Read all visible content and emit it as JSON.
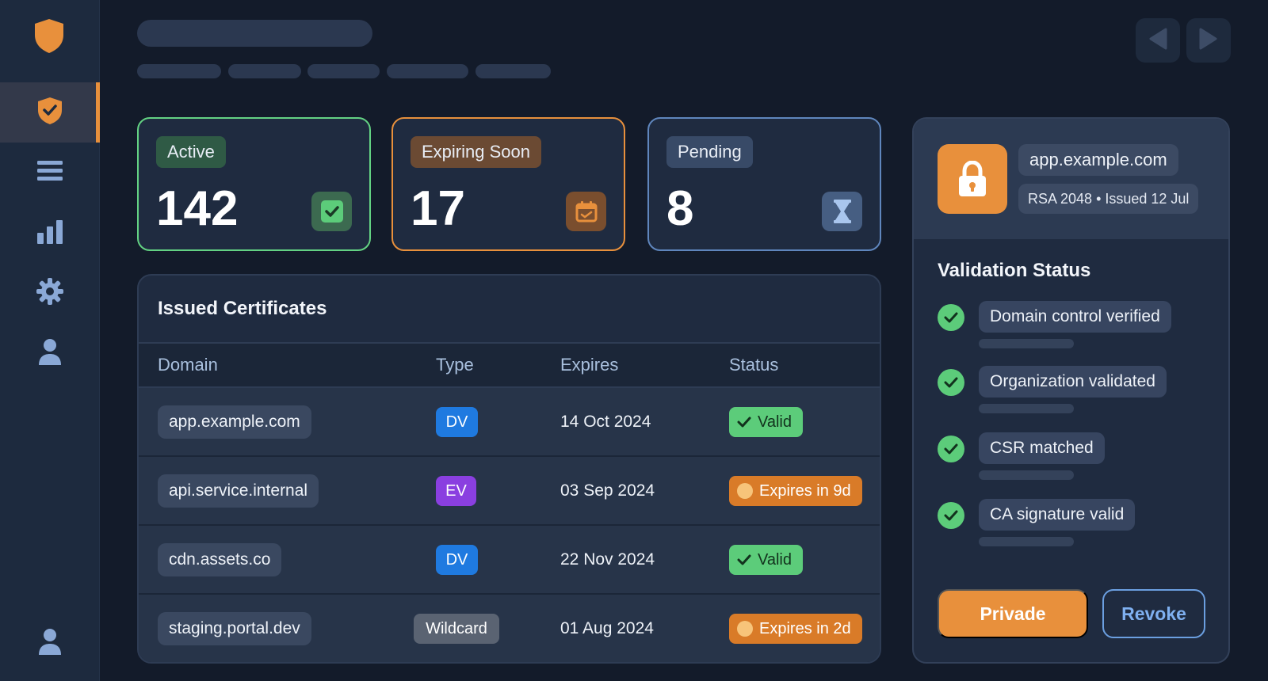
{
  "stats": [
    {
      "label": "Active",
      "value": "142",
      "icon": "check-square-icon",
      "color": "#63d283"
    },
    {
      "label": "Expiring Soon",
      "value": "17",
      "icon": "calendar-icon",
      "color": "#e8903c"
    },
    {
      "label": "Pending",
      "value": "8",
      "icon": "hourglass-icon",
      "color": "#6b9fe0"
    }
  ],
  "table": {
    "title": "Issued Certificates",
    "headers": [
      "Domain",
      "Type",
      "Expires",
      "Status"
    ],
    "rows": [
      {
        "domain": "app.example.com",
        "type": "DV",
        "expires": "14 Oct 2024",
        "status": "Valid"
      },
      {
        "domain": "api.service.internal",
        "type": "EV",
        "expires": "03 Sep 2024",
        "status": "Expires in 9d"
      },
      {
        "domain": "cdn.assets.co",
        "type": "DV",
        "expires": "22 Nov 2024",
        "status": "Valid"
      },
      {
        "domain": "staging.portal.dev",
        "type": "Wildcard",
        "expires": "01 Aug 2024",
        "status": "Expires in 2d"
      }
    ]
  },
  "detail": {
    "host": "app.example.com",
    "meta": "RSA 2048 • Issued 12 Jul",
    "validation_title": "Validation Status",
    "checks": [
      "Domain control verified",
      "Organization validated",
      "CSR matched",
      "CA signature valid"
    ],
    "primary_button": "Privade",
    "secondary_button": "Revoke"
  },
  "colors": {
    "accent": "#e8903c",
    "success": "#5ccc7a",
    "info": "#6b9fe0",
    "dv_badge": "#1f7ae0",
    "ev_badge": "#8a3fe0",
    "wildcard_badge": "#5a6372"
  }
}
